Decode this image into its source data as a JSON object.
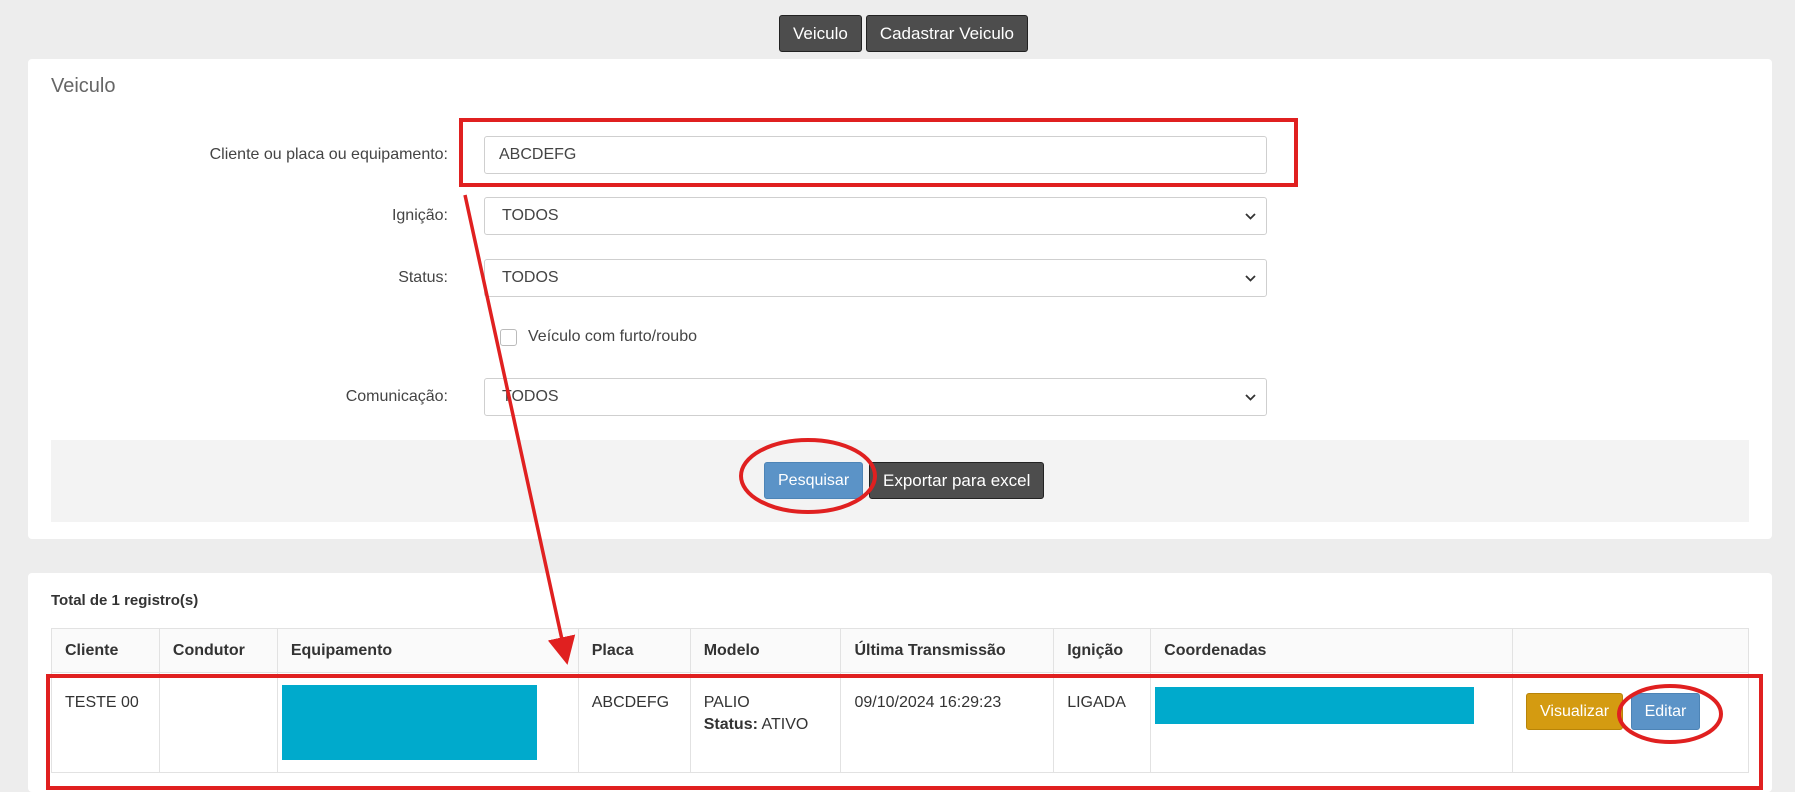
{
  "topnav": {
    "veiculo_label": "Veiculo",
    "cadastrar_label": "Cadastrar Veiculo"
  },
  "search_panel": {
    "title": "Veiculo",
    "fields": {
      "cliente": {
        "label": "Cliente ou placa ou equipamento:",
        "value": "ABCDEFG"
      },
      "ignicao": {
        "label": "Ignição:",
        "value": "TODOS"
      },
      "status": {
        "label": "Status:",
        "value": "TODOS"
      },
      "furto": {
        "label": "Veículo com furto/roubo",
        "checked": false
      },
      "comunicacao": {
        "label": "Comunicação:",
        "value": "TODOS"
      }
    },
    "pesquisar_label": "Pesquisar",
    "exportar_label": "Exportar para excel"
  },
  "results": {
    "total_text": "Total de 1 registro(s)",
    "columns": [
      "Cliente",
      "Condutor",
      "Equipamento",
      "Placa",
      "Modelo",
      "Última Transmissão",
      "Ignição",
      "Coordenadas",
      ""
    ],
    "rows": [
      {
        "cliente": "TESTE 00",
        "condutor": "",
        "placa": "ABCDEFG",
        "modelo": "PALIO",
        "status_label": "Status:",
        "status_value": "ATIVO",
        "ultima_transmissao": "09/10/2024 16:29:23",
        "ignicao": "LIGADA",
        "visualizar_label": "Visualizar",
        "editar_label": "Editar"
      }
    ]
  },
  "colors": {
    "annotation_red": "#e02020",
    "redaction": "#00aacc",
    "btn_blue": "#5b93c7",
    "btn_yellow": "#d49b11",
    "btn_dark": "#4d4d4d"
  }
}
